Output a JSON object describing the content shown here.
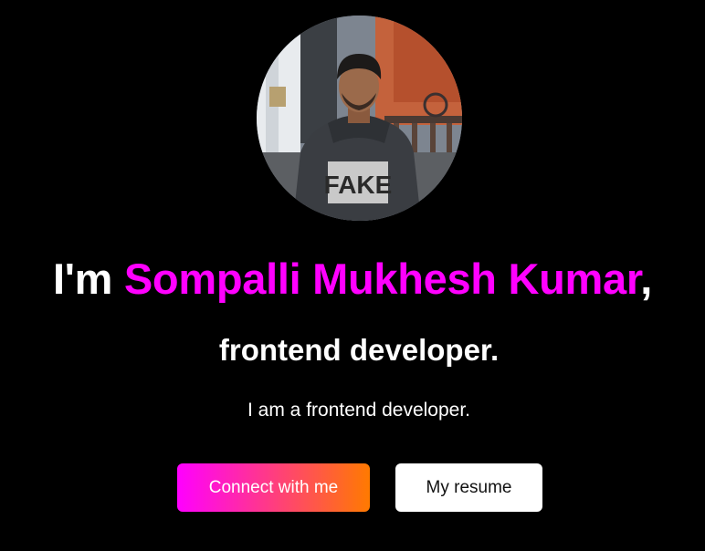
{
  "hero": {
    "headline_prefix": "I'm ",
    "name": "Sompalli Mukhesh Kumar",
    "headline_suffix": ",",
    "role": "frontend developer.",
    "description": "I am a frontend developer.",
    "shirt_text": "FAKE",
    "accent_color": "#ff00ff",
    "gradient_end_color": "#ff7a00"
  },
  "buttons": {
    "connect_label": "Connect with me",
    "resume_label": "My resume"
  }
}
